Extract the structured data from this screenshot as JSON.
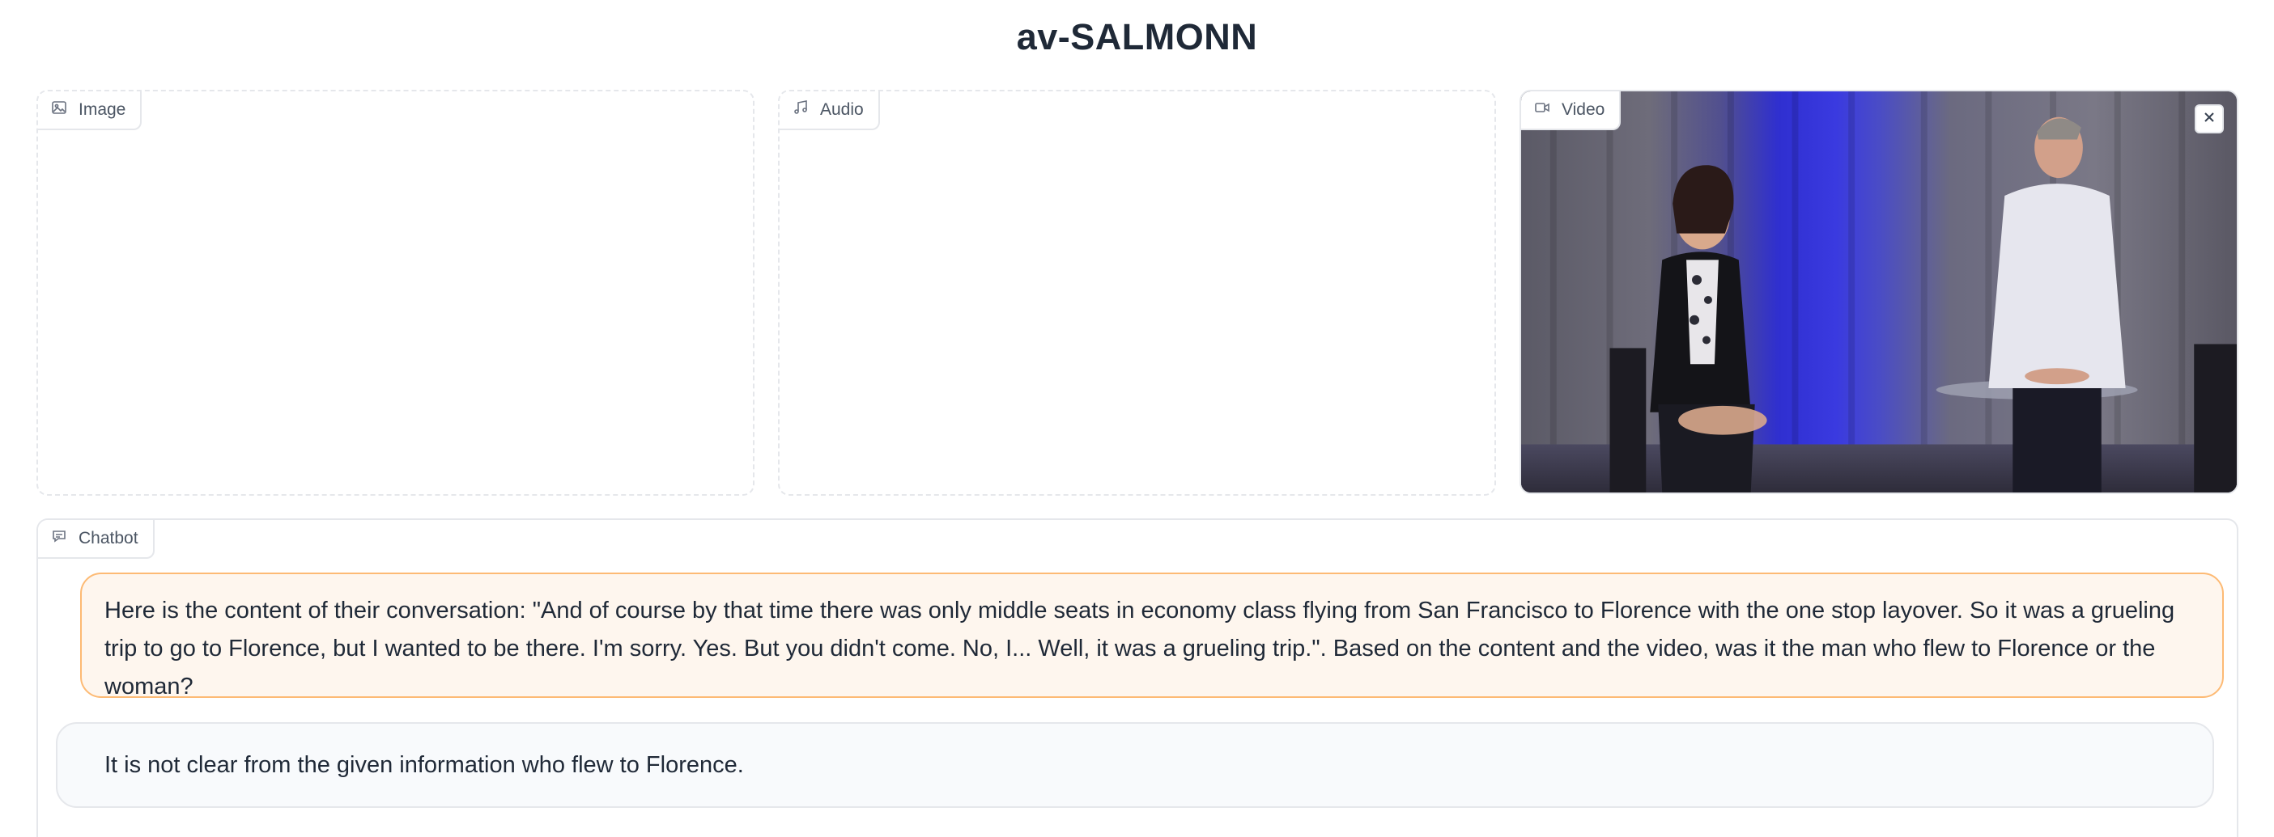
{
  "app": {
    "title": "av-SALMONN"
  },
  "inputs": {
    "image": {
      "label": "Image",
      "icon": "image-icon"
    },
    "audio": {
      "label": "Audio",
      "icon": "music-note-icon"
    },
    "video": {
      "label": "Video",
      "icon": "video-camera-icon",
      "close_icon": "close-icon"
    }
  },
  "chatbot": {
    "label": "Chatbot",
    "icon": "chat-icon",
    "messages": [
      {
        "role": "user",
        "text": "Here is the content of their conversation: \"And of course by that time there was only middle seats in economy class flying from San Francisco to Florence with the one stop layover. So it was a grueling trip to go to Florence, but I wanted to be there. I'm sorry. Yes. But you didn't come. No, I... Well, it was a grueling trip.\". Based on the content and the video, was it the man who flew to Florence or the woman?"
      },
      {
        "role": "bot",
        "text": "It is not clear from the given information who flew to Florence."
      }
    ]
  },
  "colors": {
    "user_bubble_bg": "#fef6ee",
    "user_bubble_border": "#fdba74",
    "bot_bubble_bg": "#f8fafc",
    "border": "#e5e7eb",
    "stage_light": "#3b3bd9"
  }
}
